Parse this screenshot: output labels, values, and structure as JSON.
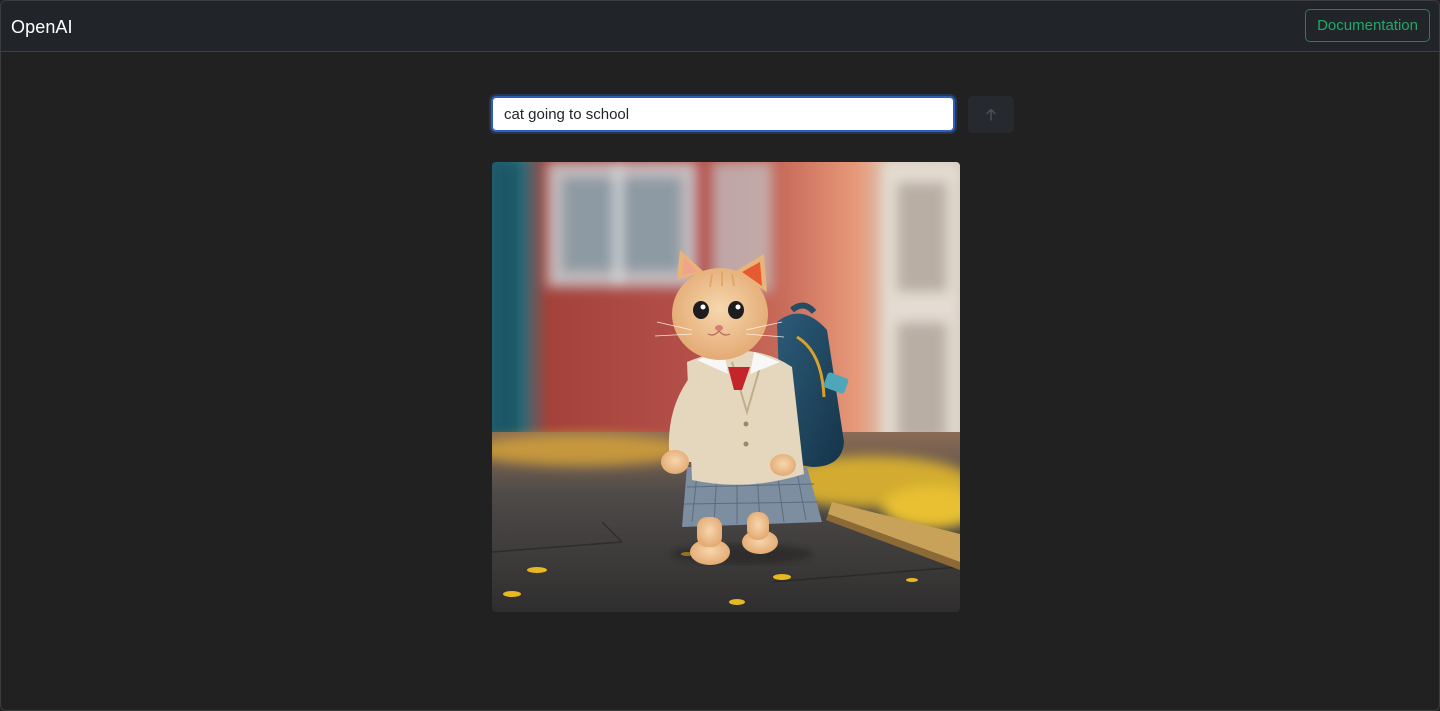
{
  "navbar": {
    "brand": "OpenAI",
    "documentation_label": "Documentation"
  },
  "prompt": {
    "value": "cat going to school",
    "submit_icon": "arrow-up-icon"
  },
  "result": {
    "image_alt": "cat going to school"
  },
  "colors": {
    "background": "#212121",
    "navbar": "#212529",
    "accent_green": "#198754",
    "focus_blue": "#2f5fb8"
  }
}
